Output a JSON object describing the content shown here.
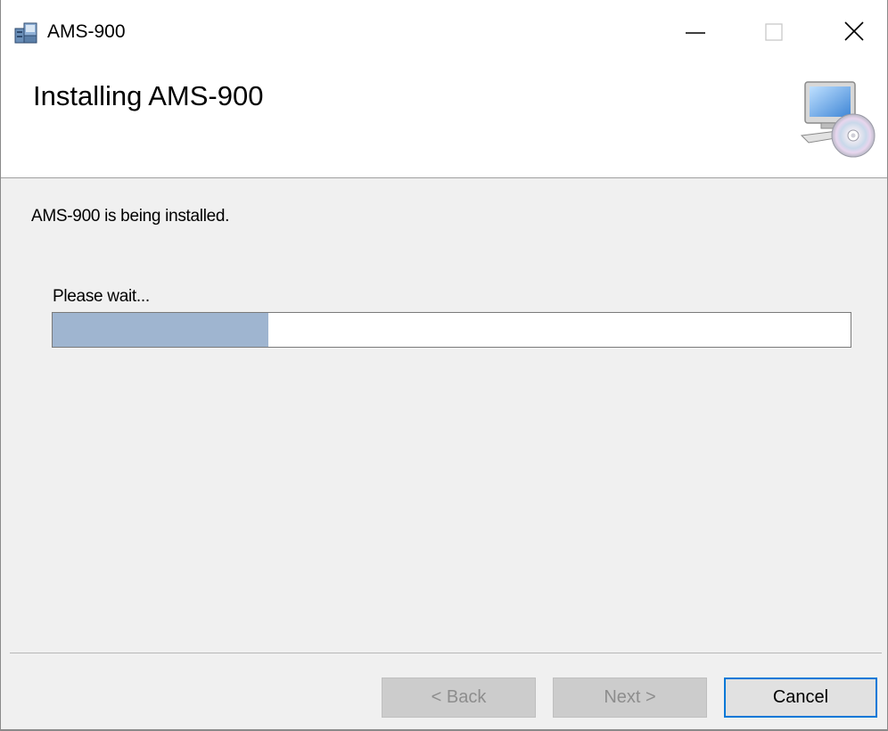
{
  "window": {
    "title": "AMS-900",
    "app_icon": "installer-package-icon",
    "controls": {
      "minimize_icon": "minimize-icon",
      "maximize_icon": "maximize-icon",
      "close_icon": "close-icon"
    }
  },
  "header": {
    "title": "Installing AMS-900",
    "icon": "computer-cd-icon"
  },
  "body": {
    "status": "AMS-900 is being installed.",
    "wait_label": "Please wait...",
    "progress_fraction": 0.27,
    "progress_color": "#9fb5d0"
  },
  "buttons": {
    "back": "< Back",
    "next": "Next >",
    "cancel": "Cancel"
  },
  "colors": {
    "focus_border": "#0078d7",
    "dialog_background": "#f0f0f0"
  }
}
